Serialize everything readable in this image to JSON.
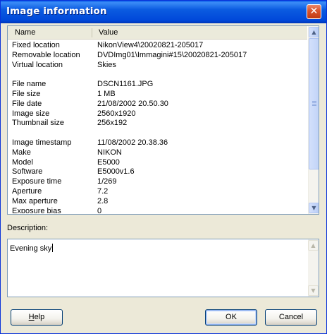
{
  "window": {
    "title": "Image information",
    "close_glyph": "✕"
  },
  "list": {
    "headers": {
      "name": "Name",
      "value": "Value"
    },
    "rows": [
      {
        "name": "Fixed location",
        "value": "NikonView4\\20020821-205017"
      },
      {
        "name": "Removable location",
        "value": "DVDImg01\\Immagini#15\\20020821-205017"
      },
      {
        "name": "Virtual location",
        "value": "Skies"
      },
      {
        "name": "",
        "value": ""
      },
      {
        "name": "File name",
        "value": "DSCN1161.JPG"
      },
      {
        "name": "File size",
        "value": "1 MB"
      },
      {
        "name": "File date",
        "value": "21/08/2002 20.50.30"
      },
      {
        "name": "Image size",
        "value": "2560x1920"
      },
      {
        "name": "Thumbnail size",
        "value": "256x192"
      },
      {
        "name": "",
        "value": ""
      },
      {
        "name": "Image timestamp",
        "value": "11/08/2002 20.38.36"
      },
      {
        "name": "Make",
        "value": "NIKON"
      },
      {
        "name": "Model",
        "value": "E5000"
      },
      {
        "name": "Software",
        "value": "E5000v1.6"
      },
      {
        "name": "Exposure time",
        "value": "1/269"
      },
      {
        "name": "Aperture",
        "value": "7.2"
      },
      {
        "name": "Max aperture",
        "value": "2.8"
      },
      {
        "name": "Exposure bias",
        "value": "0"
      }
    ]
  },
  "description": {
    "label": "Description:",
    "text": "Evening sky"
  },
  "buttons": {
    "help": {
      "mnemonic": "H",
      "rest": "elp"
    },
    "ok": "OK",
    "cancel": "Cancel"
  },
  "icons": {
    "scroll_up": "up-arrow-icon",
    "scroll_down": "down-arrow-icon",
    "close": "close-icon"
  },
  "colors": {
    "titlebar": "#0054e3",
    "close_button": "#d9532c",
    "dialog_face": "#ece9d8",
    "field_border": "#7f9db9",
    "scrollbar": "#c2d4f8"
  }
}
